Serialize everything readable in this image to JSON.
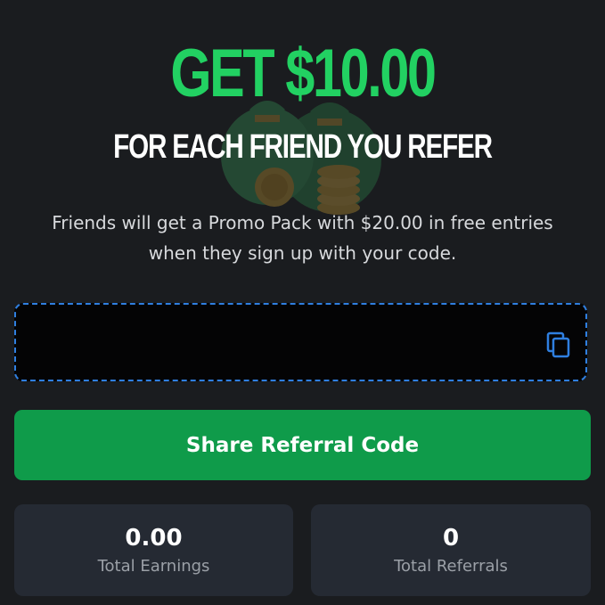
{
  "hero": {
    "headline": "GET $10.00",
    "subheadline": "FOR EACH FRIEND YOU REFER",
    "description": "Friends will get a Promo Pack with $20.00 in free entries when they sign up with your code.",
    "illustration_icon": "money-bag-coins-icon"
  },
  "referral_code": {
    "value": "",
    "copy_icon": "copy-icon"
  },
  "share_button": {
    "label": "Share Referral Code"
  },
  "stats": {
    "earnings": {
      "value": "0.00",
      "label": "Total Earnings"
    },
    "referrals": {
      "value": "0",
      "label": "Total Referrals"
    }
  },
  "colors": {
    "background": "#1a1c1f",
    "accent_green": "#22d162",
    "button_green": "#0f9b4a",
    "dashed_border_blue": "#2f7fe0",
    "card_background": "#252a33"
  }
}
